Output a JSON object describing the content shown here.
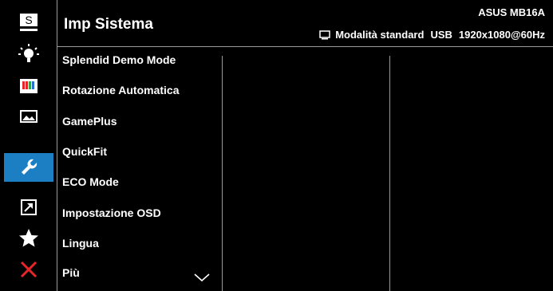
{
  "header": {
    "title": "Imp Sistema",
    "model": "ASUS MB16A",
    "mode": "Modalità standard",
    "input": "USB",
    "resolution": "1920x1080@60Hz"
  },
  "sidebar": {
    "items": [
      {
        "icon": "splendid-s-icon",
        "label": "S"
      },
      {
        "icon": "bluelight-bulb-icon"
      },
      {
        "icon": "color-bars-icon"
      },
      {
        "icon": "image-icon"
      },
      {
        "icon": "wrench-icon",
        "active": true
      },
      {
        "icon": "shortcut-arrow-icon"
      },
      {
        "icon": "star-icon"
      },
      {
        "icon": "close-x-icon"
      }
    ]
  },
  "menu": {
    "items": [
      "Splendid Demo Mode",
      "Rotazione Automatica",
      "GamePlus",
      "QuickFit",
      "ECO Mode",
      "Impostazione OSD",
      "Lingua",
      "Più"
    ]
  },
  "colors": {
    "background": "#000000",
    "accent": "#1c7fc4",
    "close": "#e8262a",
    "separator": "#9a9a9a"
  }
}
